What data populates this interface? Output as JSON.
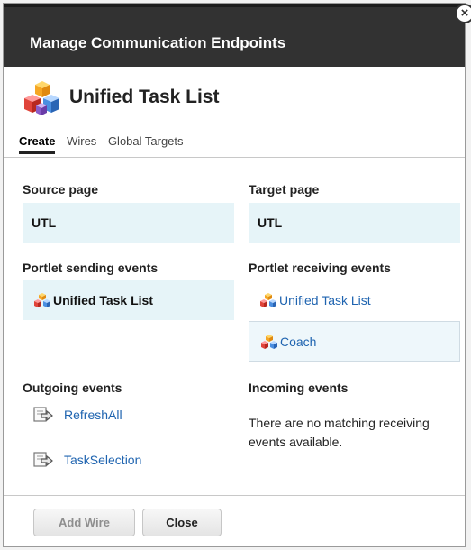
{
  "dialog": {
    "title": "Manage Communication Endpoints",
    "close_symbol": "×"
  },
  "header": {
    "portlet_name": "Unified Task List",
    "icon": "portlet-blocks-icon"
  },
  "tabs": [
    {
      "label": "Create",
      "active": true
    },
    {
      "label": "Wires",
      "active": false
    },
    {
      "label": "Global Targets",
      "active": false
    }
  ],
  "source": {
    "label": "Source page",
    "value": "UTL",
    "portlets_label": "Portlet sending events",
    "portlets": [
      "Unified Task List"
    ],
    "events_label": "Outgoing events",
    "events": [
      "RefreshAll",
      "TaskSelection"
    ]
  },
  "target": {
    "label": "Target page",
    "value": "UTL",
    "portlets_label": "Portlet receiving events",
    "portlets": [
      "Unified Task List",
      "Coach"
    ],
    "events_label": "Incoming events",
    "events_message": "There are no matching receiving events available."
  },
  "buttons": {
    "add_wire": "Add Wire",
    "close": "Close"
  },
  "colors": {
    "title_bar": "#323232",
    "selection_bg": "#e6f4f8",
    "link": "#1f64b0"
  }
}
